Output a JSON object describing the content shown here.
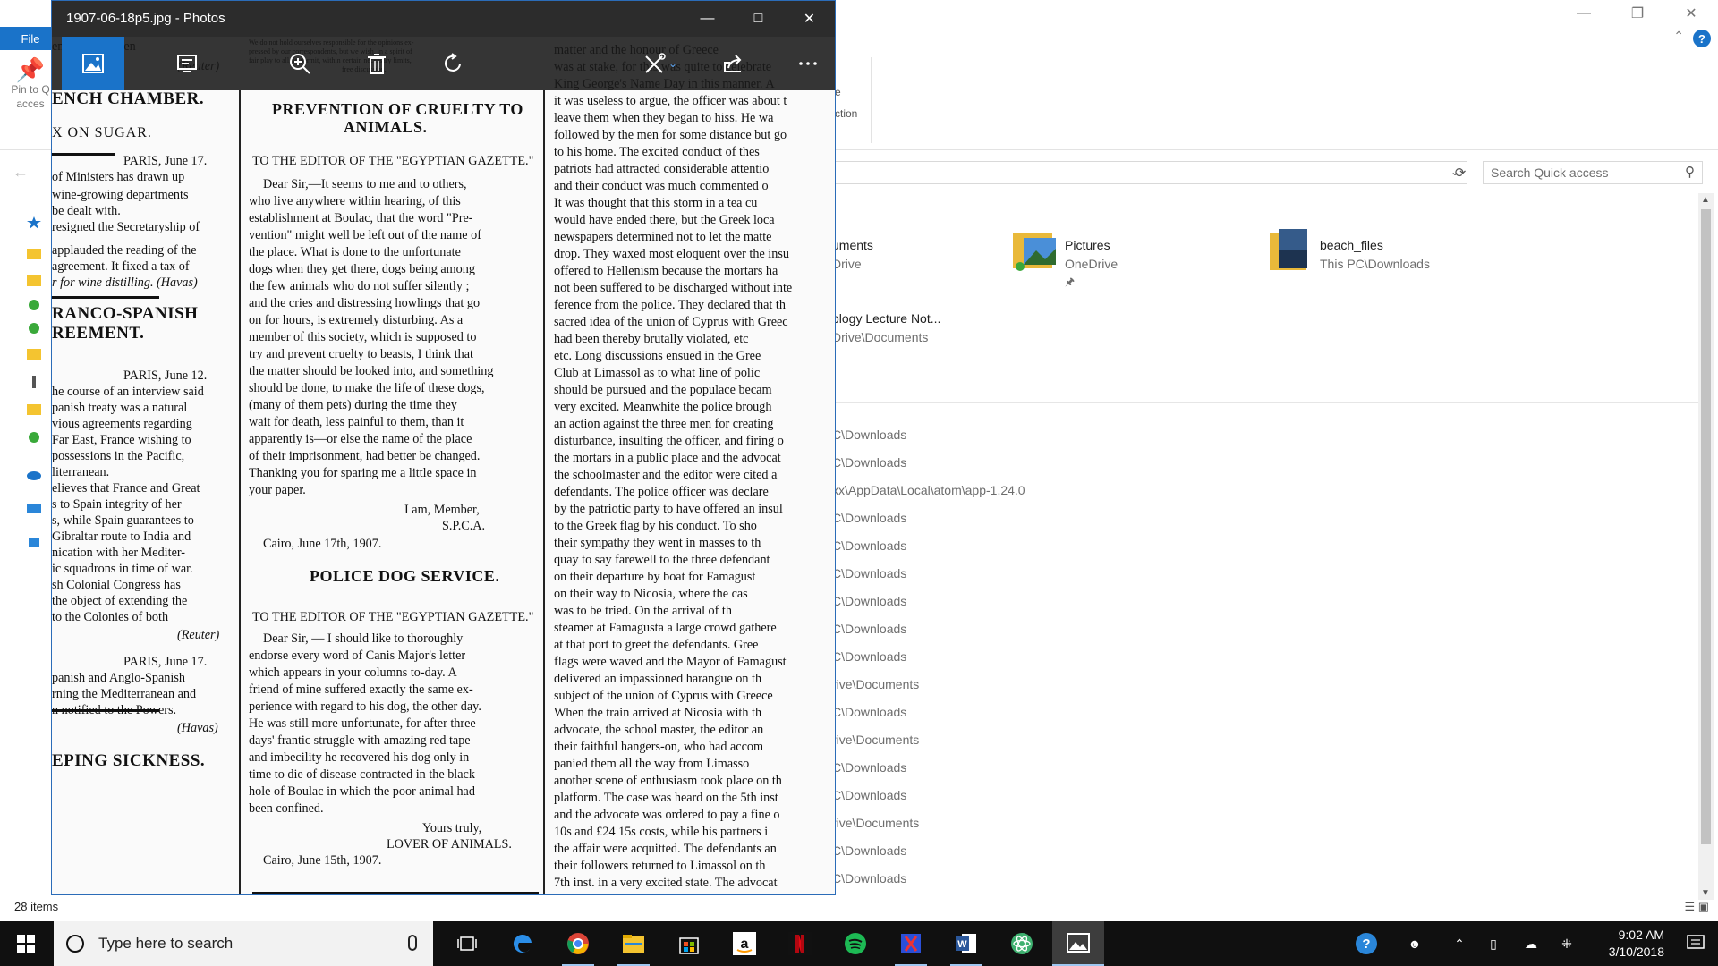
{
  "explorer": {
    "file_tab": "File",
    "ribbon": {
      "pin_label": "Pin to Q",
      "pin_label2": "acces",
      "partial_e": "e",
      "partial_ction": "ction"
    },
    "search_placeholder": "Search Quick access",
    "tiles": [
      {
        "name": "uments",
        "sub": "Drive",
        "icon": "documents-folder-icon"
      },
      {
        "name": "Pictures",
        "sub": "OneDrive",
        "icon": "pictures-folder-icon"
      },
      {
        "name": "beach_files",
        "sub": "This PC\\Downloads",
        "icon": "beach-folder-icon"
      },
      {
        "name": "ology Lecture Not...",
        "sub": "Drive\\Documents",
        "icon": "none"
      }
    ],
    "recent": [
      "C\\Downloads",
      "C\\Downloads",
      "xx\\AppData\\Local\\atom\\app-1.24.0",
      "C\\Downloads",
      "C\\Downloads",
      "C\\Downloads",
      "C\\Downloads",
      "C\\Downloads",
      "C\\Downloads",
      "rive\\Documents",
      "C\\Downloads",
      "rive\\Documents",
      "C\\Downloads",
      "C\\Downloads",
      "rive\\Documents",
      "C\\Downloads",
      "C\\Downloads"
    ],
    "status": "28 items"
  },
  "photos": {
    "title": "1907-06-18p5.jpg - Photos",
    "toolbar": [
      "collection-icon",
      "slideshow-icon",
      "zoom-icon",
      "delete-icon",
      "rotate-icon",
      "edit-create-icon",
      "share-icon",
      "more-icon"
    ]
  },
  "paper": {
    "col1": [
      "ember dead men",
      "(Reuter)",
      "ENCH  CHAMBER.",
      "X ON SUGAR.",
      "PARIS, June 17.",
      "of Ministers has drawn up",
      "wine-growing departments",
      "be dealt with.",
      "resigned the Secretaryship of",
      "applauded the reading of the",
      "agreement.  It fixed a tax of",
      "r for wine distilling. (Havas)",
      "RANCO-SPANISH",
      "REEMENT.",
      "PARIS, June 12.",
      "he course of an interview said",
      "panish treaty was a natural",
      "vious agreements regarding",
      "Far East, France wishing to",
      "possessions in the Pacific,",
      "literranean.",
      "elieves that France and Great",
      "s to Spain integrity of her",
      "s, while Spain guarantees to",
      "Gibraltar route to India and",
      "nication with her Mediter-",
      "ic squadrons in time of war.",
      "sh Colonial Congress has",
      "the object of extending the",
      "to the Colonies of both",
      "(Reuter)",
      "PARIS, June 17.",
      "panish and Anglo-Spanish",
      "rning the Mediterranean and",
      "n notified to the Powers.",
      "(Havas)",
      "EPING  SICKNESS."
    ],
    "col2_header": "We do not hold ourselves responsible for the opinions ex-",
    "col2_header2": "pressed by our correspondents, but we wish, in a spirit of",
    "col2_header3": "fair play to all, to permit, within certain necessary limits,",
    "col2_header4": "free discussion.",
    "col2_title1": "PREVENTION OF CRUELTY TO",
    "col2_title2": "ANIMALS.",
    "col2_to1": "TO THE EDITOR OF THE \"EGYPTIAN GAZETTE.\"",
    "col2_letter1": [
      "Dear Sir,—It seems to me and to others,",
      "who live anywhere within hearing, of this",
      "establishment at Boulac, that the word \"Pre-",
      "vention\" might well be left out of the name of",
      "the place.  What is done to the unfortunate",
      "dogs when they get there, dogs being among",
      "the few animals who do not suffer silently ;",
      "and the cries and distressing howlings that go",
      "on for hours, is extremely disturbing.  As a",
      "member of this society, which is supposed to",
      "try and prevent cruelty to beasts, I think that",
      "the matter should be looked into, and something",
      "should be done, to make the life of these dogs,",
      "(many of them pets) during the time they",
      "wait for death, less painful to them, than it",
      "apparently is—or else the name of the place",
      "of their imprisonment, had better be changed.",
      "Thanking you for sparing me a little space in",
      "your paper."
    ],
    "col2_sign1a": "I am, Member,",
    "col2_sign1b": "S.P.C.A.",
    "col2_date1": "Cairo, June 17th, 1907.",
    "col2_title3": "POLICE DOG SERVICE.",
    "col2_to2": "TO THE EDITOR OF THE \"EGYPTIAN GAZETTE.\"",
    "col2_letter2": [
      "Dear Sir, — I should like to thoroughly",
      "endorse every word of Canis Major's letter",
      "which appears in your columns to-day.  A",
      "friend of mine suffered exactly the same ex-",
      "perience with regard to his dog, the other day.",
      "He was still more unfortunate, for after three",
      "days' frantic struggle with amazing red tape",
      "and imbecility he recovered his dog only in",
      "time to die of disease contracted in the black",
      "hole of Boulac in which the poor animal had",
      "been confined."
    ],
    "col2_sign2a": "Yours truly,",
    "col2_sign2b": "LOVER OF ANIMALS.",
    "col2_date2": "Cairo, June 15th, 1907.",
    "col3": [
      "matter and the honour of Greece",
      "was at stake, for this was quite to celebrate",
      "King George's Name Day in this manner. A",
      "it was useless to argue, the officer was about t",
      "leave them when they began to hiss. He wa",
      "followed by the men for some distance but go",
      "to his home.  The excited conduct of thes",
      "patriots had attracted considerable attentio",
      "and their conduct was much commented o",
      "It was thought that this storm in a tea cu",
      "would have ended there, but the Greek loca",
      "newspapers determined not to let the matte",
      "drop. They waxed most eloquent over the insu",
      "offered to Hellenism because the mortars ha",
      "not been suffered to be discharged without inte",
      "ference from the police. They declared that th",
      "sacred idea of the union of Cyprus with Greec",
      "had been thereby brutally violated, etc",
      "etc.  Long discussions ensued in the Gree",
      "Club at Limassol as to what line of polic",
      "should be pursued and the populace becam",
      "very excited.  Meanwhite the police brough",
      "an action against the three men for creating",
      "disturbance, insulting the officer, and firing o",
      "the mortars in a public place and the advocat",
      "the schoolmaster and the editor were cited a",
      "defendants.  The police officer was declare",
      "by the patriotic party to have offered an insul",
      "to the Greek flag by his conduct.  To sho",
      "their sympathy they went in masses to th",
      "quay to say farewell to the three defendant",
      "on their departure by boat for Famagust",
      "on their way to Nicosia, where the cas",
      "was to be tried.  On the arrival of th",
      "steamer at Famagusta a large crowd gathere",
      "at that port to greet the defendants. Gree",
      "flags were waved and the Mayor of Famagust",
      "delivered an impassioned harangue on th",
      "subject of the union of Cyprus with Greece",
      "When the train arrived at Nicosia with th",
      "advocate, the school master, the editor an",
      "their faithful hangers-on, who had accom",
      "panied them all the way from Limasso",
      "another scene of enthusiasm took place on th",
      "platform. The case was heard on the 5th inst",
      "and the advocate was ordered to pay a fine o",
      "10s and £24 15s costs, while his partners i",
      "the affair were acquitted. The defendants an",
      "their followers returned to Limassol on th",
      "7th inst. in a very excited state. The advocat"
    ]
  },
  "taskbar": {
    "search_text": "Type here to search",
    "time": "9:02 AM",
    "date": "3/10/2018"
  }
}
